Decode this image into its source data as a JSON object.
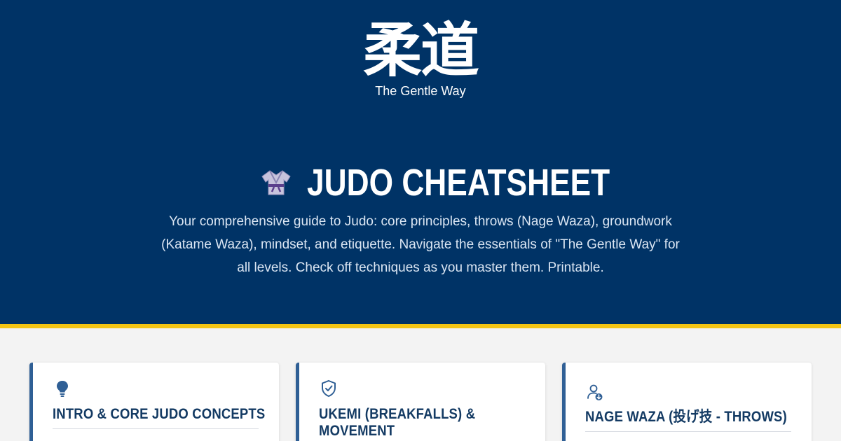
{
  "header": {
    "kanji": "柔道",
    "kanji_subtitle": "The Gentle Way",
    "title": "JUDO CHEATSHEET",
    "title_icon": "judo-gi-icon",
    "description": "Your comprehensive guide to Judo: core principles, throws (Nage Waza), groundwork (Katame Waza), mindset, and etiquette. Navigate the essentials of \"The Gentle Way\" for all levels. Check off techniques as you master them. Printable."
  },
  "cards": [
    {
      "icon": "lightbulb-icon",
      "title_lines": [
        "INTRO & CORE JUDO CONCEPTS"
      ]
    },
    {
      "icon": "shield-check-icon",
      "title_lines": [
        "UKEMI (BREAKFALLS) &",
        "MOVEMENT"
      ]
    },
    {
      "icon": "user-download-icon",
      "title_lines": [
        "NAGE WAZA (投げ技 - THROWS)"
      ]
    }
  ],
  "colors": {
    "hero_bg": "#003366",
    "accent": "#f4c514",
    "page_bg": "#f3f3f3",
    "card_border": "#2f5f95",
    "card_title": "#133a63"
  }
}
